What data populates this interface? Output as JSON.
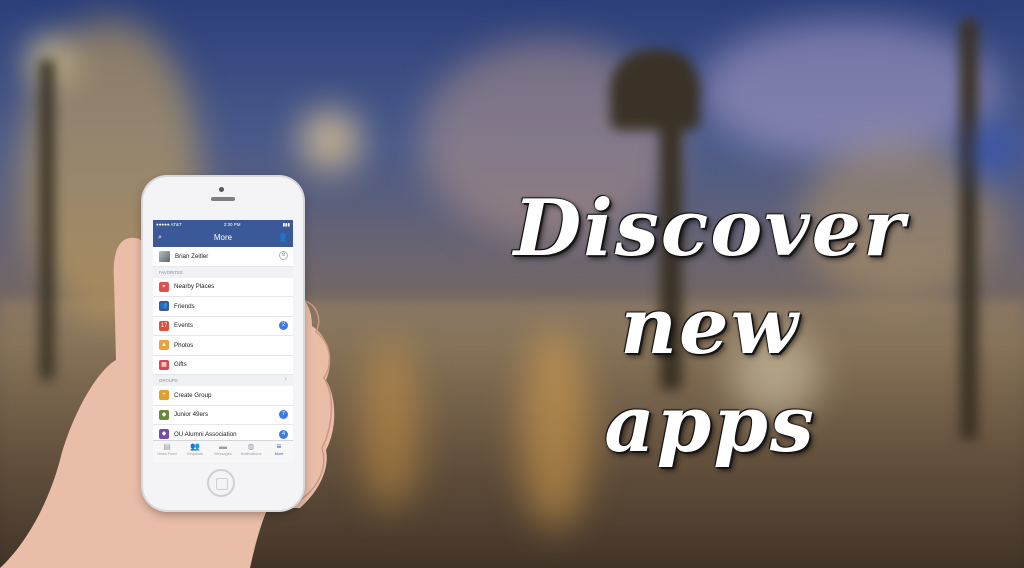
{
  "headline": {
    "line1": "Discover new",
    "line2": "apps"
  },
  "phone": {
    "status": {
      "carrier": "●●●●● AT&T",
      "time": "2:30 PM"
    },
    "nav": {
      "title": "More",
      "search_icon": "search-icon",
      "friends_icon": "friend-requests-icon"
    },
    "profile": {
      "name": "Brian Zeitler"
    },
    "favorites_header": "FAVORITES",
    "favorites": [
      {
        "label": "Nearby Places",
        "icon": "map-pin-icon",
        "color": "#d9534f",
        "glyph": "⌖",
        "badge": ""
      },
      {
        "label": "Friends",
        "icon": "friends-icon",
        "color": "#3b5998",
        "glyph": "👥",
        "badge": ""
      },
      {
        "label": "Events",
        "icon": "calendar-icon",
        "color": "#e04f3a",
        "glyph": "17",
        "badge": "2"
      },
      {
        "label": "Photos",
        "icon": "photos-icon",
        "color": "#e8a33a",
        "glyph": "▲",
        "badge": ""
      },
      {
        "label": "Gifts",
        "icon": "gift-icon",
        "color": "#d24b4b",
        "glyph": "▦",
        "badge": ""
      }
    ],
    "groups_header": "GROUPS",
    "groups": [
      {
        "label": "Create Group",
        "icon": "create-group-icon",
        "color": "#e0a030",
        "glyph": "+",
        "badge": ""
      },
      {
        "label": "Junior 49ers",
        "icon": "group-icon",
        "color": "#6a8a3a",
        "glyph": "◆",
        "badge": "7"
      },
      {
        "label": "OU Alumni Association",
        "icon": "group-icon",
        "color": "#7b4aa8",
        "glyph": "◆",
        "badge": "4"
      }
    ],
    "tabs": [
      {
        "label": "News Feed",
        "icon": "news-feed-icon",
        "glyph": "▤",
        "active": false
      },
      {
        "label": "Requests",
        "icon": "requests-icon",
        "glyph": "👥",
        "active": false
      },
      {
        "label": "Messages",
        "icon": "messages-icon",
        "glyph": "▬",
        "active": false
      },
      {
        "label": "Notifications",
        "icon": "globe-icon",
        "glyph": "◍",
        "active": false
      },
      {
        "label": "More",
        "icon": "menu-icon",
        "glyph": "≡",
        "active": true
      }
    ]
  }
}
